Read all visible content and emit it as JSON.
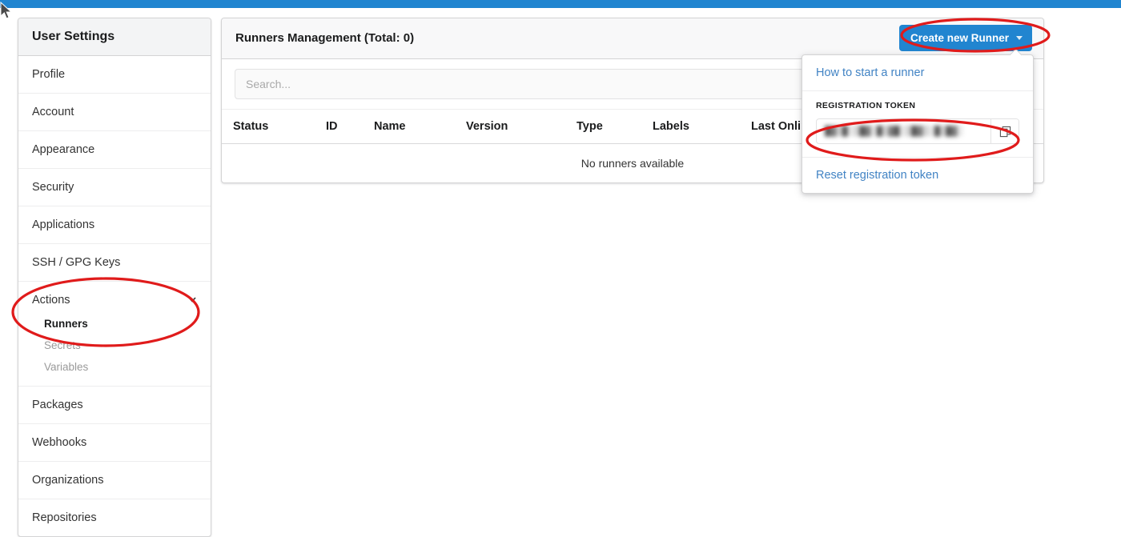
{
  "theme": {
    "topbar_color": "#2185d0",
    "primary_button_color": "#2185d0",
    "link_color": "#4183c4",
    "annotation_color": "#e01b1b"
  },
  "sidebar": {
    "title": "User Settings",
    "items": [
      {
        "label": "Profile"
      },
      {
        "label": "Account"
      },
      {
        "label": "Appearance"
      },
      {
        "label": "Security"
      },
      {
        "label": "Applications"
      },
      {
        "label": "SSH / GPG Keys"
      },
      {
        "label": "Actions",
        "expanded": true,
        "chevron": "chevron-down-icon",
        "children": [
          {
            "label": "Runners",
            "active": true
          },
          {
            "label": "Secrets",
            "active": false
          },
          {
            "label": "Variables",
            "active": false
          }
        ]
      },
      {
        "label": "Packages"
      },
      {
        "label": "Webhooks"
      },
      {
        "label": "Organizations"
      },
      {
        "label": "Repositories"
      }
    ]
  },
  "main": {
    "header_title": "Runners Management (Total: 0)",
    "create_button_label": "Create new Runner",
    "create_button_caret": "caret-down-icon",
    "search_placeholder": "Search...",
    "search_value": "",
    "table": {
      "columns": [
        "Status",
        "ID",
        "Name",
        "Version",
        "Type",
        "Labels",
        "Last Online"
      ],
      "rows": [],
      "empty_message": "No runners available"
    }
  },
  "dropdown": {
    "how_to_link": "How to start a runner",
    "token_label": "REGISTRATION TOKEN",
    "token_value": "█▓▒█░▒█▓░█▒▓█░▒█▓▒░█▒█▓░",
    "copy_icon": "copy-icon",
    "reset_link": "Reset registration token"
  },
  "annotations": [
    {
      "name": "actions-runners-highlight"
    },
    {
      "name": "create-new-runner-highlight"
    },
    {
      "name": "registration-token-highlight"
    }
  ]
}
